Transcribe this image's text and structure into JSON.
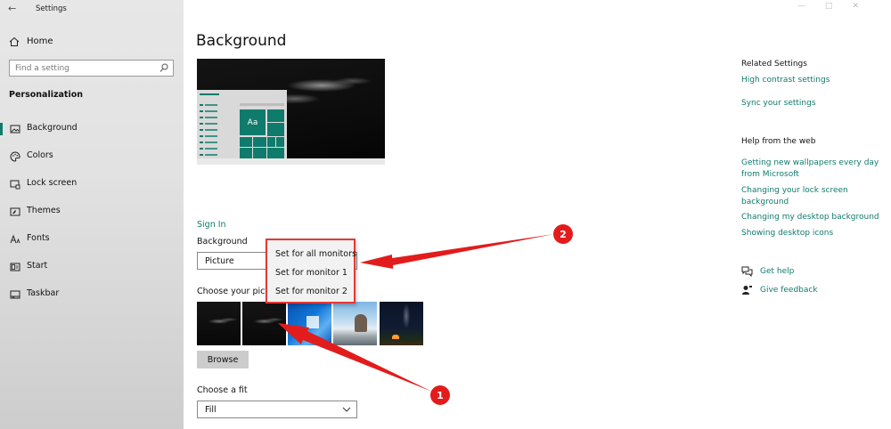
{
  "window": {
    "app_title": "Settings"
  },
  "sidebar": {
    "home_label": "Home",
    "search_placeholder": "Find a setting",
    "section_title": "Personalization",
    "items": [
      {
        "label": "Background",
        "icon": "picture-icon",
        "active": true
      },
      {
        "label": "Colors",
        "icon": "palette-icon",
        "active": false
      },
      {
        "label": "Lock screen",
        "icon": "lock-screen-icon",
        "active": false
      },
      {
        "label": "Themes",
        "icon": "themes-icon",
        "active": false
      },
      {
        "label": "Fonts",
        "icon": "fonts-icon",
        "active": false
      },
      {
        "label": "Start",
        "icon": "start-icon",
        "active": false
      },
      {
        "label": "Taskbar",
        "icon": "taskbar-icon",
        "active": false
      }
    ]
  },
  "main": {
    "title": "Background",
    "preview": {
      "tile_text": "Aa"
    },
    "sign_in": "Sign In",
    "background_label": "Background",
    "background_value": "Picture",
    "choose_picture_label": "Choose your pictu",
    "browse_label": "Browse",
    "fit_label": "Choose a fit",
    "fit_value": "Fill",
    "context_menu": [
      "Set for all monitors",
      "Set for monitor 1",
      "Set for monitor 2"
    ]
  },
  "annotations": {
    "badge_1": "1",
    "badge_2": "2"
  },
  "right_panel": {
    "related_title": "Related Settings",
    "related_links": [
      "High contrast settings",
      "Sync your settings"
    ],
    "help_title": "Help from the web",
    "help_links": [
      "Getting new wallpapers every day from Microsoft",
      "Changing your lock screen background",
      "Changing my desktop background",
      "Showing desktop icons"
    ],
    "get_help": "Get help",
    "give_feedback": "Give feedback"
  },
  "colors": {
    "accent": "#0f7b6c",
    "annotation_red": "#e21c1c",
    "sidebar_bg": "#e2e2e2"
  }
}
